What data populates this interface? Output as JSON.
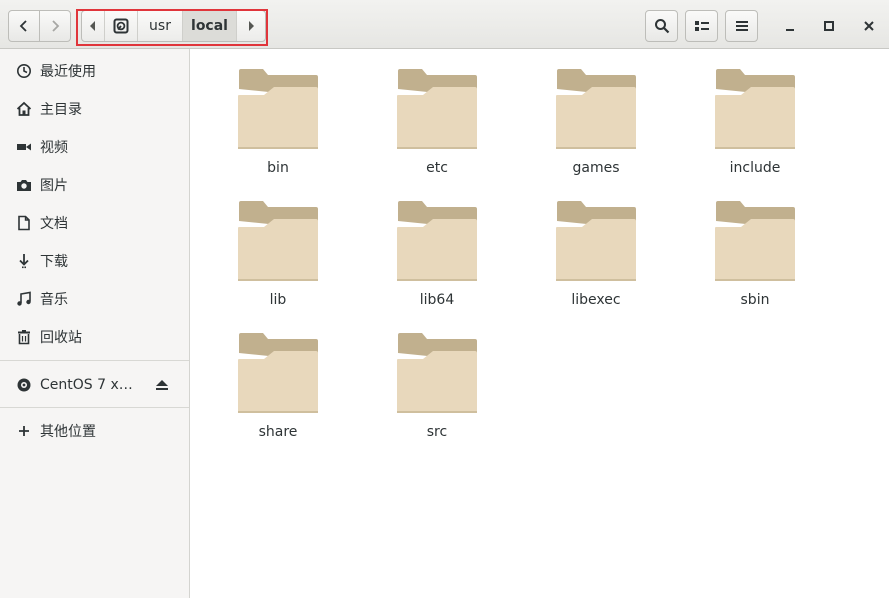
{
  "header": {
    "nav": {
      "back_icon": "go-back-icon",
      "forward_icon": "go-forward-icon"
    },
    "pathbar": {
      "left_arrow_icon": "path-left-arrow-icon",
      "root_icon": "filesystem-root-icon",
      "segments": [
        "usr",
        "local"
      ],
      "active_segment": "local",
      "right_arrow_icon": "path-right-arrow-icon"
    },
    "tools": {
      "search_icon": "search-icon",
      "view_icon": "list-view-icon",
      "menu_icon": "hamburger-menu-icon"
    },
    "window_controls": [
      "minimize-icon",
      "maximize-icon",
      "close-icon"
    ]
  },
  "sidebar": {
    "items": [
      {
        "label": "最近使用",
        "icon": "recent-clock-icon"
      },
      {
        "label": "主目录",
        "icon": "home-icon"
      },
      {
        "label": "视频",
        "icon": "video-icon"
      },
      {
        "label": "图片",
        "icon": "camera-icon"
      },
      {
        "label": "文档",
        "icon": "document-icon"
      },
      {
        "label": "下载",
        "icon": "download-icon"
      },
      {
        "label": "音乐",
        "icon": "music-icon"
      },
      {
        "label": "回收站",
        "icon": "trash-icon"
      }
    ],
    "devices": [
      {
        "label": "CentOS 7 x…",
        "icon": "disc-icon",
        "action_icon": "eject-icon"
      }
    ],
    "other": {
      "label": "其他位置",
      "icon": "plus-icon"
    }
  },
  "files": [
    {
      "name": "bin"
    },
    {
      "name": "etc"
    },
    {
      "name": "games"
    },
    {
      "name": "include"
    },
    {
      "name": "lib"
    },
    {
      "name": "lib64"
    },
    {
      "name": "libexec"
    },
    {
      "name": "sbin"
    },
    {
      "name": "share"
    },
    {
      "name": "src"
    }
  ],
  "colors": {
    "folder_back": "#c1b08e",
    "folder_front": "#e8d8bc",
    "highlight_border": "#e0353b"
  }
}
